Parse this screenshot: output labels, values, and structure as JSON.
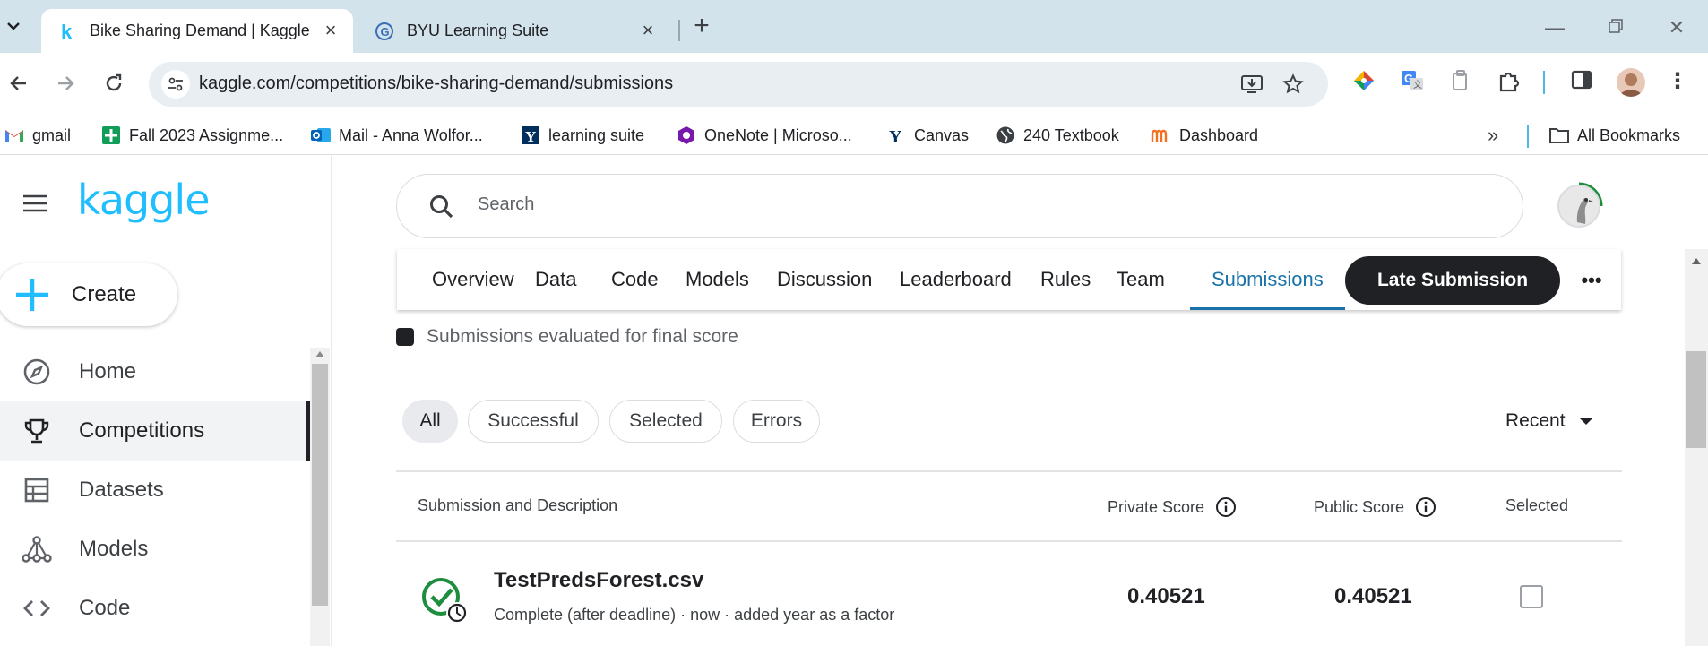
{
  "browser": {
    "tabs": [
      {
        "title": "Bike Sharing Demand | Kaggle",
        "icon": "kaggle-k-icon",
        "active": true
      },
      {
        "title": "BYU Learning Suite",
        "icon": "learning-suite-icon",
        "active": false
      }
    ],
    "new_tab_label": "+",
    "url": "kaggle.com/competitions/bike-sharing-demand/submissions",
    "bookmarks": [
      {
        "label": "gmail",
        "icon": "gmail-icon"
      },
      {
        "label": "Fall 2023 Assignme...",
        "icon": "sheets-plus-icon"
      },
      {
        "label": "Mail - Anna Wolfor...",
        "icon": "outlook-icon"
      },
      {
        "label": "learning suite",
        "icon": "y-icon"
      },
      {
        "label": "OneNote | Microso...",
        "icon": "onenote-icon"
      },
      {
        "label": "Canvas",
        "icon": "canvas-y-icon"
      },
      {
        "label": "240 Textbook",
        "icon": "globe-icon"
      },
      {
        "label": "Dashboard",
        "icon": "dashboard-m-icon"
      }
    ],
    "all_bookmarks": "All Bookmarks"
  },
  "sidebar": {
    "logo": "kaggle",
    "create_label": "Create",
    "items": [
      {
        "label": "Home",
        "icon": "compass-icon"
      },
      {
        "label": "Competitions",
        "icon": "trophy-icon",
        "active": true
      },
      {
        "label": "Datasets",
        "icon": "table-icon"
      },
      {
        "label": "Models",
        "icon": "models-icon"
      },
      {
        "label": "Code",
        "icon": "code-icon"
      }
    ]
  },
  "search": {
    "placeholder": "Search"
  },
  "competition_tabs": [
    "Overview",
    "Data",
    "Code",
    "Models",
    "Discussion",
    "Leaderboard",
    "Rules",
    "Team",
    "Submissions"
  ],
  "selected_tab": "Submissions",
  "late_submission_label": "Late Submission",
  "legend_text": "Submissions evaluated for final score",
  "filters": [
    "All",
    "Successful",
    "Selected",
    "Errors"
  ],
  "sort_label": "Recent",
  "table": {
    "headers": {
      "submission": "Submission and Description",
      "private": "Private Score",
      "public": "Public Score",
      "selected": "Selected"
    },
    "rows": [
      {
        "file": "TestPredsForest.csv",
        "description": "Complete (after deadline) · now · added year as a factor",
        "private_score": "0.40521",
        "public_score": "0.40521",
        "selected": false
      }
    ]
  },
  "colors": {
    "kaggle_blue": "#20beff",
    "accent_tab": "#1a73a8",
    "success_green": "#1e8e3e",
    "dark": "#202124"
  }
}
